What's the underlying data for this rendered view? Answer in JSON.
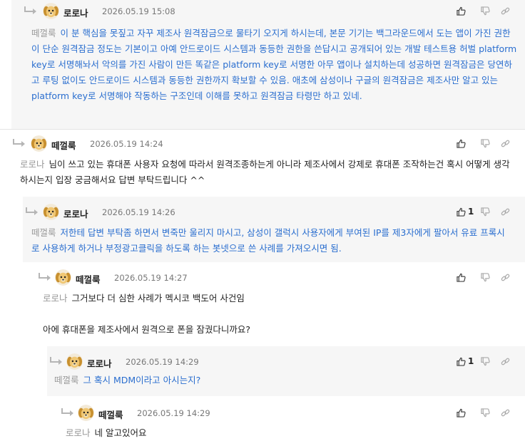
{
  "comments": [
    {
      "nick": "로로나",
      "date": "2026.05.19 15:08",
      "mention": "떼껄룩",
      "text": "이 분 핵심을 못짚고 자꾸 제조사 원격잠금으로 물타기 오지게 하시는데, 본문 기기는 백그라운드에서 도는 앱이 가진 권한이 단순 원격잠금 정도는 기본이고 아예 안드로이드 시스템과 동등한 권한을 쓴답시고 공개되어 있는 개발 테스트용 허벌 platform key로 서명해놔서 악의를 가진 사람이 만든 똑같은 platform key로 서명한 아무 앱이나 설치하는데 성공하면 원격잠금은 당연하고 루팅 없이도 안드로이드 시스템과 동등한 권한까지 확보할 수 있음. 애초에 삼성이나 구글의 원격잠금은 제조사만 알고 있는 platform key로 서명해야 작동하는 구조인데 이해를 못하고 원격잠금 타령만 하고 있네.",
      "like_count": ""
    },
    {
      "nick": "떼껄룩",
      "date": "2026.05.19 14:24",
      "mention": "로로나",
      "text": "님이 쓰고 있는 휴대폰 사용자 요청에 따라서 원격조종하는게 아니라 제조사에서 강제로 휴대폰 조작하는건 혹시 어떻게 생각하시는지 입장 궁금해서요 답변 부탁드립니다 ^^",
      "like_count": ""
    },
    {
      "nick": "로로나",
      "date": "2026.05.19 14:26",
      "mention": "떼껄룩",
      "text": "저한테 답변 부탁좀 하면서 변죽만 울리지 마시고, 삼성이 갤럭시 사용자에게 부여된 IP를 제3자에게 팔아서 유료 프록시로 사용하게 하거나 부정광고클릭을 하도록 하는 봇넷으로 쓴 사례를 가져오시면 됨.",
      "like_count": "1"
    },
    {
      "nick": "떼껄룩",
      "date": "2026.05.19 14:27",
      "mention": "로로나",
      "text": "그거보다 더 심한 사례가 멕시코 백도어 사건임",
      "text2": "아에 휴대폰을 제조사에서 원격으로 폰을 잠궜다니까요?",
      "like_count": ""
    },
    {
      "nick": "로로나",
      "date": "2026.05.19 14:29",
      "mention": "떼껄룩",
      "text": "그 혹시 MDM이라고 아시는지?",
      "like_count": "1"
    },
    {
      "nick": "떼껄룩",
      "date": "2026.05.19 14:29",
      "mention": "로로나",
      "text": "네 알고있어요",
      "like_count": ""
    }
  ],
  "icons": {
    "reply": "reply-arrow-icon",
    "like": "thumbs-up-icon",
    "dislike": "thumbs-down-icon",
    "link": "link-icon",
    "avatar": "puppy-avatar"
  },
  "colors": {
    "reply_text": "#2a6ecf",
    "mention": "#999999",
    "date": "#777777",
    "shaded_bg": "#f6f6f6"
  }
}
